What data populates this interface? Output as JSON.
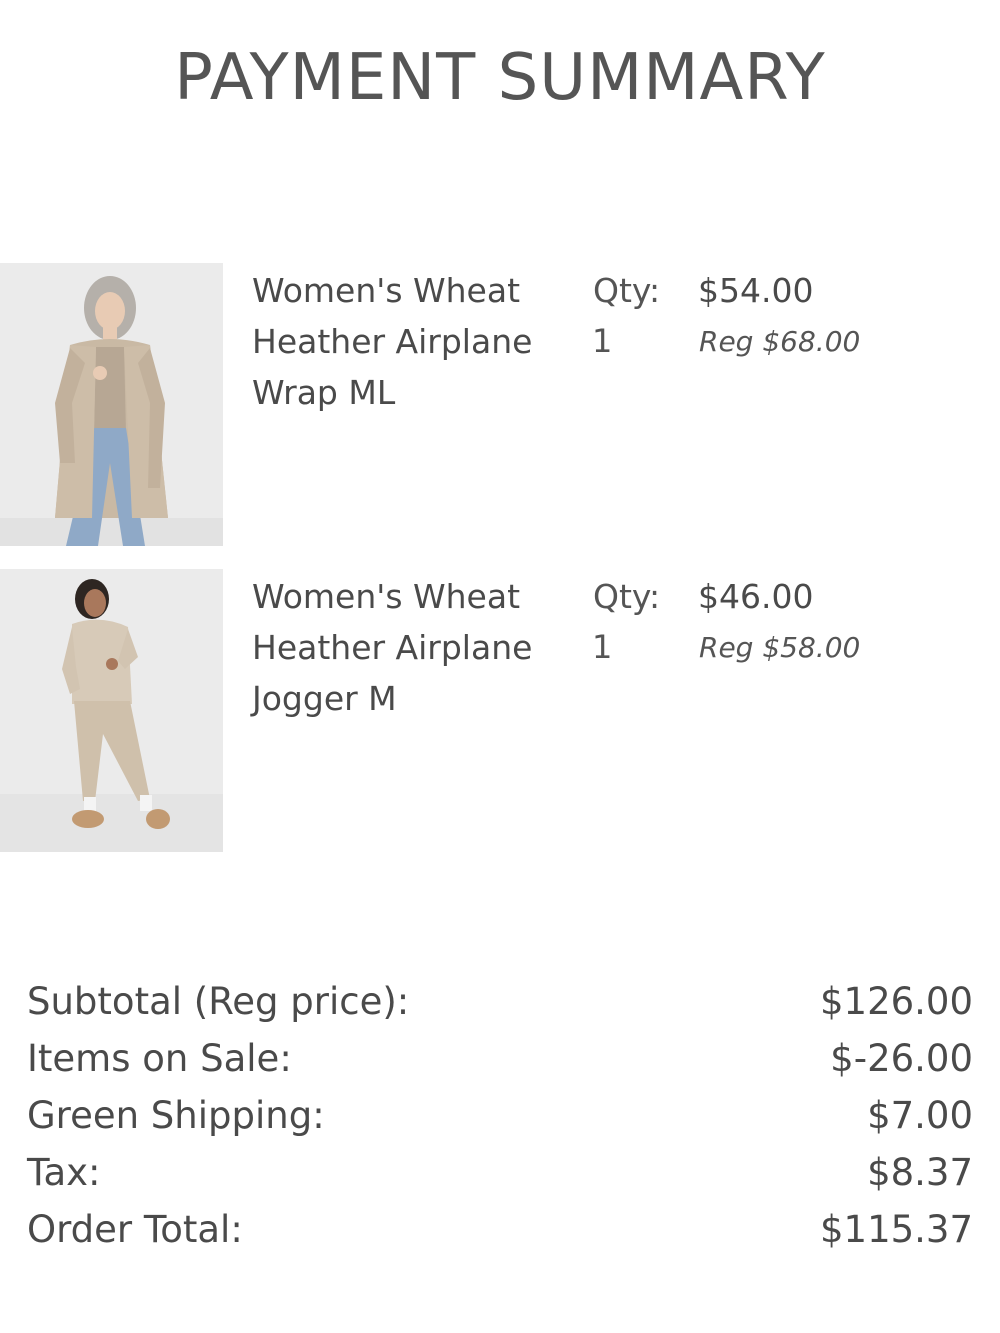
{
  "page": {
    "title": "PAYMENT SUMMARY"
  },
  "items": [
    {
      "name": "Women's Wheat Heather Airplane Wrap ML",
      "qty_label": "Qty:",
      "qty": "1",
      "price": "$54.00",
      "reg_price": "Reg $68.00",
      "image_icon": "product-photo-cardigan"
    },
    {
      "name": "Women's Wheat Heather Airplane Jogger M",
      "qty_label": "Qty:",
      "qty": "1",
      "price": "$46.00",
      "reg_price": "Reg $58.00",
      "image_icon": "product-photo-jogger"
    }
  ],
  "summary": {
    "rows": [
      {
        "label": "Subtotal (Reg price):",
        "value": "$126.00"
      },
      {
        "label": "Items on Sale:",
        "value": "$-26.00"
      },
      {
        "label": "Green Shipping:",
        "value": "$7.00"
      },
      {
        "label": "Tax:",
        "value": "$8.37"
      },
      {
        "label": "Order Total:",
        "value": "$115.37"
      }
    ]
  },
  "colors": {
    "text": "#4a4a4a",
    "title": "#555555",
    "background": "#ffffff",
    "photo_background": "#ebebeb",
    "garment": "#c9b9a4"
  }
}
